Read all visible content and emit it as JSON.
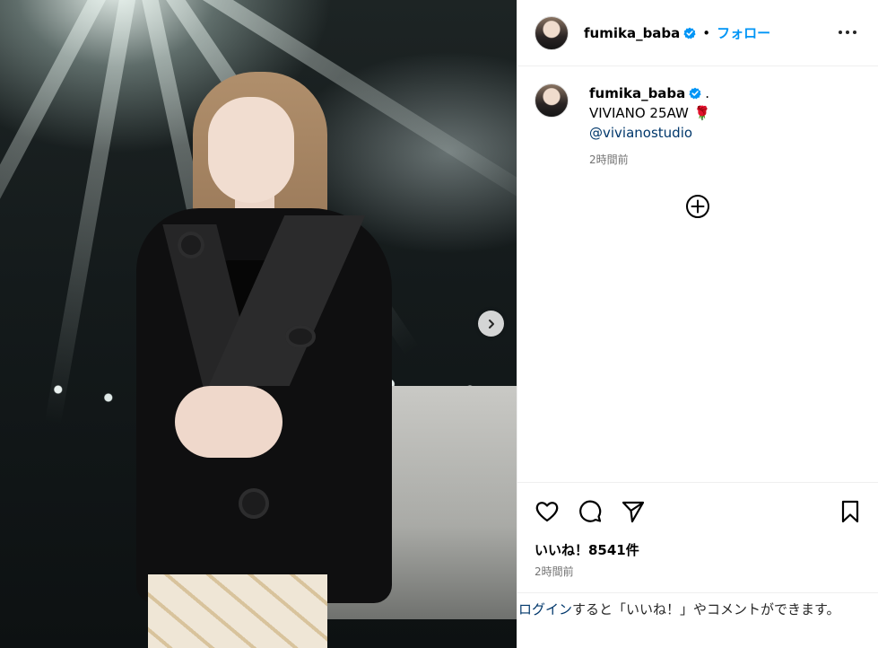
{
  "post": {
    "username": "fumika_baba",
    "follow_label": "フォロー",
    "separator": "•",
    "verified_icon": "verified-badge-icon",
    "more_icon": "more-options-icon"
  },
  "caption": {
    "username": "fumika_baba",
    "dot": ".",
    "line1": "VIVIANO 25AW",
    "emoji": "🌹",
    "mention": "@vivianostudio",
    "time": "2時間前"
  },
  "photo": {
    "next_icon": "chevron-right-icon"
  },
  "actions": {
    "like_icon": "heart-icon",
    "comment_icon": "comment-icon",
    "share_icon": "send-icon",
    "save_icon": "bookmark-icon",
    "add_comment_icon": "plus-circle-icon"
  },
  "stats": {
    "likes": "いいね！8541件",
    "time": "2時間前"
  },
  "login_prompt": {
    "link": "ログイン",
    "rest": "すると「いいね！」やコメントができます。"
  },
  "colors": {
    "accent": "#0095f6",
    "mention": "#00376b",
    "muted": "#737373",
    "verified": "#0095f6"
  }
}
